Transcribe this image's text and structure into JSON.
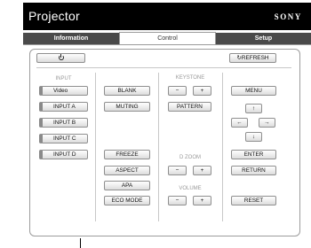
{
  "header": {
    "title": "Projector",
    "brand": "SONY"
  },
  "tabs": [
    {
      "label": "Information"
    },
    {
      "label": "Control"
    },
    {
      "label": "Setup"
    }
  ],
  "toolbar": {
    "power_icon": "power-icon",
    "refresh_label": "REFRESH"
  },
  "input": {
    "label": "INPUT",
    "items": [
      "Video",
      "INPUT A",
      "INPUT B",
      "INPUT C",
      "INPUT D"
    ]
  },
  "picture": {
    "blank": "BLANK",
    "muting": "MUTING",
    "freeze": "FREEZE",
    "aspect": "ASPECT",
    "apa": "APA",
    "eco_mode": "ECO MODE"
  },
  "keystone": {
    "label": "KEYSTONE",
    "minus": "−",
    "plus": "+",
    "pattern": "PATTERN"
  },
  "dzoom": {
    "label": "D ZOOM",
    "minus": "−",
    "plus": "+"
  },
  "volume": {
    "label": "VOLUME",
    "minus": "−",
    "plus": "+"
  },
  "menu": {
    "menu": "MENU",
    "up": "↑",
    "left": "←",
    "right": "→",
    "down": "↓",
    "enter": "ENTER",
    "return": "RETURN",
    "reset": "RESET"
  }
}
